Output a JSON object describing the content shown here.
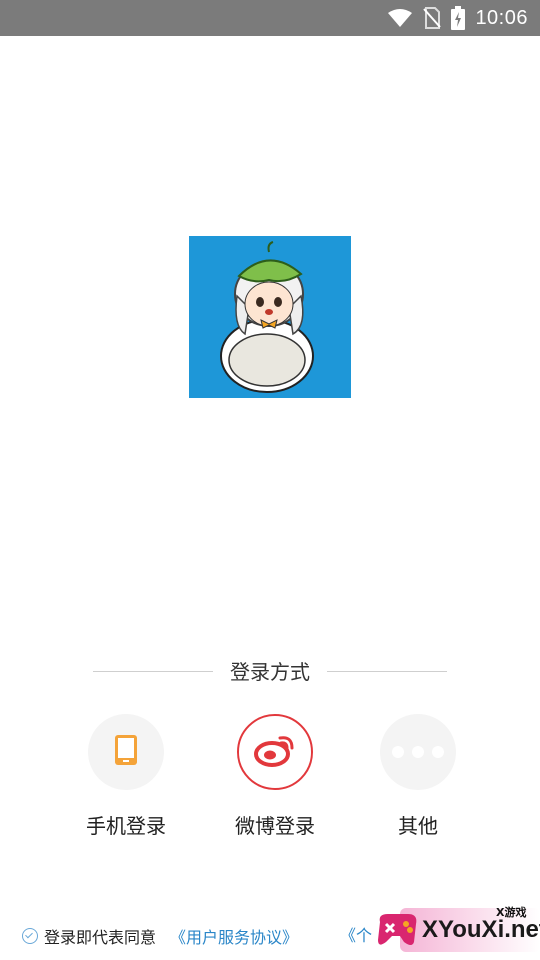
{
  "status_bar": {
    "time": "10:06",
    "icons": [
      "wifi-icon",
      "no-sim-icon",
      "battery-charging-icon"
    ]
  },
  "logo": {
    "name": "app-mascot-logo",
    "bg_color": "#1e97d8"
  },
  "login": {
    "section_title": "登录方式",
    "options": [
      {
        "label": "手机登录",
        "icon": "phone-icon",
        "color": "#f4a339"
      },
      {
        "label": "微博登录",
        "icon": "weibo-icon",
        "color": "#e2383c"
      },
      {
        "label": "其他",
        "icon": "more-dots-icon"
      }
    ]
  },
  "agreement": {
    "prefix": "登录即代表同意",
    "link_terms": "《用户服务协议》",
    "link_privacy_partial": "《个"
  },
  "watermark": {
    "text": "XYouXi.net",
    "small_text": "X游戏"
  }
}
